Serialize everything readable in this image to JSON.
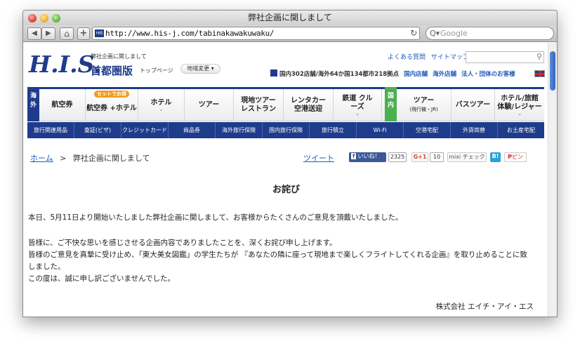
{
  "window": {
    "title": "弊社企画に関しまして"
  },
  "toolbar": {
    "back_icon": "◀",
    "forward_icon": "▶",
    "home_icon": "⌂",
    "add_icon": "+",
    "favicon_text": "HIS",
    "url": "http://www.his-j.com/tabinakawakuwaku/",
    "reload_icon": "↻",
    "search_placeholder": "Google",
    "search_icon": "Q▾"
  },
  "header": {
    "logo": "H.I.S.",
    "small_title": "弊社企画に関しまして",
    "region": "首都圏版",
    "top_page": "トップページ",
    "change_area": "地域変更 ▾",
    "links": [
      "よくある質問",
      "サイトマップ"
    ],
    "stats": "国内302店舗/海外64か国134都市218拠点",
    "stat_links": [
      "国内店舗",
      "海外店舗",
      "法人・団体のお客様"
    ],
    "site_search_icon": "🔍"
  },
  "main_nav": {
    "overseas_tag": "海外",
    "domestic_tag": "国内",
    "items": [
      {
        "label": "航空券",
        "badge": "",
        "chev": false,
        "sub": ""
      },
      {
        "label": "航空券 +ホテル",
        "badge": "セットでお得",
        "chev": false,
        "sub": ""
      },
      {
        "label": "ホテル",
        "badge": "",
        "chev": true,
        "sub": ""
      },
      {
        "label": "ツアー",
        "badge": "",
        "chev": false,
        "sub": ""
      },
      {
        "label": "現地ツアー レストラン",
        "badge": "",
        "chev": false,
        "sub": ""
      },
      {
        "label": "レンタカー 空港送迎",
        "badge": "",
        "chev": false,
        "sub": ""
      },
      {
        "label": "鉄道 クルーズ",
        "badge": "",
        "chev": true,
        "sub": ""
      },
      {
        "label": "ツアー",
        "badge": "",
        "chev": false,
        "sub": "(飛行機・JR)"
      },
      {
        "label": "バスツアー",
        "badge": "",
        "chev": false,
        "sub": ""
      },
      {
        "label": "ホテル/旅館 体験/レジャー",
        "badge": "",
        "chev": true,
        "sub": ""
      }
    ]
  },
  "sub_nav": [
    "旅行関連用品",
    "査証(ビザ)",
    "クレジットカード",
    "商品券",
    "海外旅行保険",
    "国内旅行保険",
    "旅行積立",
    "Wi-Fi",
    "空港宅配",
    "外貨両替",
    "お土産宅配"
  ],
  "breadcrumb": {
    "home": "ホーム",
    "separator": ">",
    "current": "弊社企画に関しまして"
  },
  "social": {
    "tweet": "ツイート",
    "like": "いいね！",
    "like_count": "2325",
    "gplus": "G+1",
    "gplus_count": "10",
    "mixi": "mixi チェック",
    "hatena": "B!",
    "pin": "ピン"
  },
  "content": {
    "heading": "お詫び",
    "p1": "本日、5月11日より開始いたしました弊社企画に関しまして、お客様からたくさんのご意見を頂戴いたしました。",
    "p2_line1": "皆様に、ご不快な思いを感じさせる企画内容でありましたことを、深くお詫び申し上げます。",
    "p2_line2": "皆様のご意見を真摯に受け止め、「東大美女図鑑」の学生たちが 『あなたの隣に座って現地まで楽しくフライトしてくれる企画』を取り止めることに致",
    "p2_line3": "しました。",
    "p2_line4": "この度は、誠に申し訳ございませんでした。",
    "company": "株式会社 エイチ・アイ・エス"
  },
  "colors": {
    "brand": "#1f3c8c",
    "domestic": "#4caf50",
    "badge": "#f39a1e",
    "link": "#1f5bb8"
  }
}
